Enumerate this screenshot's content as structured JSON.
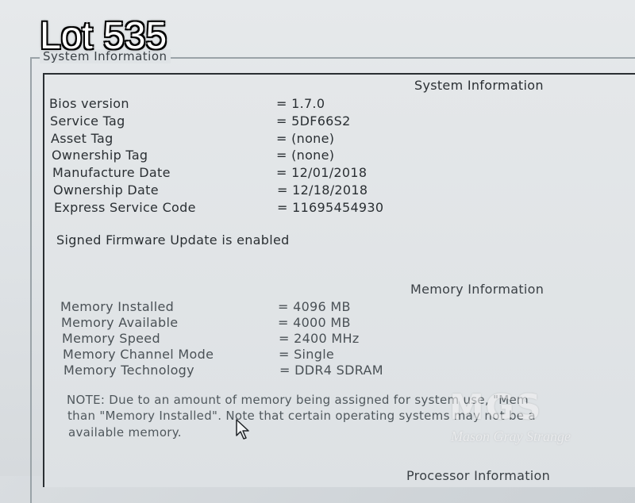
{
  "overlay": {
    "lot": "Lot 535"
  },
  "group": {
    "title": "System Information"
  },
  "system": {
    "heading": "System Information",
    "rows": [
      {
        "label": "Bios version",
        "value": "= 1.7.0"
      },
      {
        "label": "Service Tag",
        "value": "= 5DF66S2"
      },
      {
        "label": "Asset Tag",
        "value": "= (none)"
      },
      {
        "label": "Ownership Tag",
        "value": "= (none)"
      },
      {
        "label": "Manufacture Date",
        "value": "= 12/01/2018"
      },
      {
        "label": "Ownership Date",
        "value": "= 12/18/2018"
      },
      {
        "label": "Express Service Code",
        "value": "= 11695454930"
      }
    ],
    "firmware_status": "Signed Firmware Update is enabled"
  },
  "memory": {
    "heading": "Memory Information",
    "rows": [
      {
        "label": "Memory Installed",
        "value": "= 4096 MB"
      },
      {
        "label": "Memory Available",
        "value": "= 4000 MB"
      },
      {
        "label": "Memory Speed",
        "value": "= 2400 MHz"
      },
      {
        "label": "Memory Channel Mode",
        "value": "= Single"
      },
      {
        "label": "Memory Technology",
        "value": "= DDR4 SDRAM"
      }
    ],
    "note": {
      "line1": "NOTE: Due to an amount of memory being assigned for system use, \"Mem",
      "line2": "than \"Memory Installed\". Note that certain operating systems may not be a",
      "line3": "available memory."
    }
  },
  "processor": {
    "heading": "Processor Information"
  },
  "watermark": {
    "logo": "MGS",
    "text": "Mason Gray Strange"
  },
  "icons": {
    "cursor": "mouse-pointer-icon"
  }
}
